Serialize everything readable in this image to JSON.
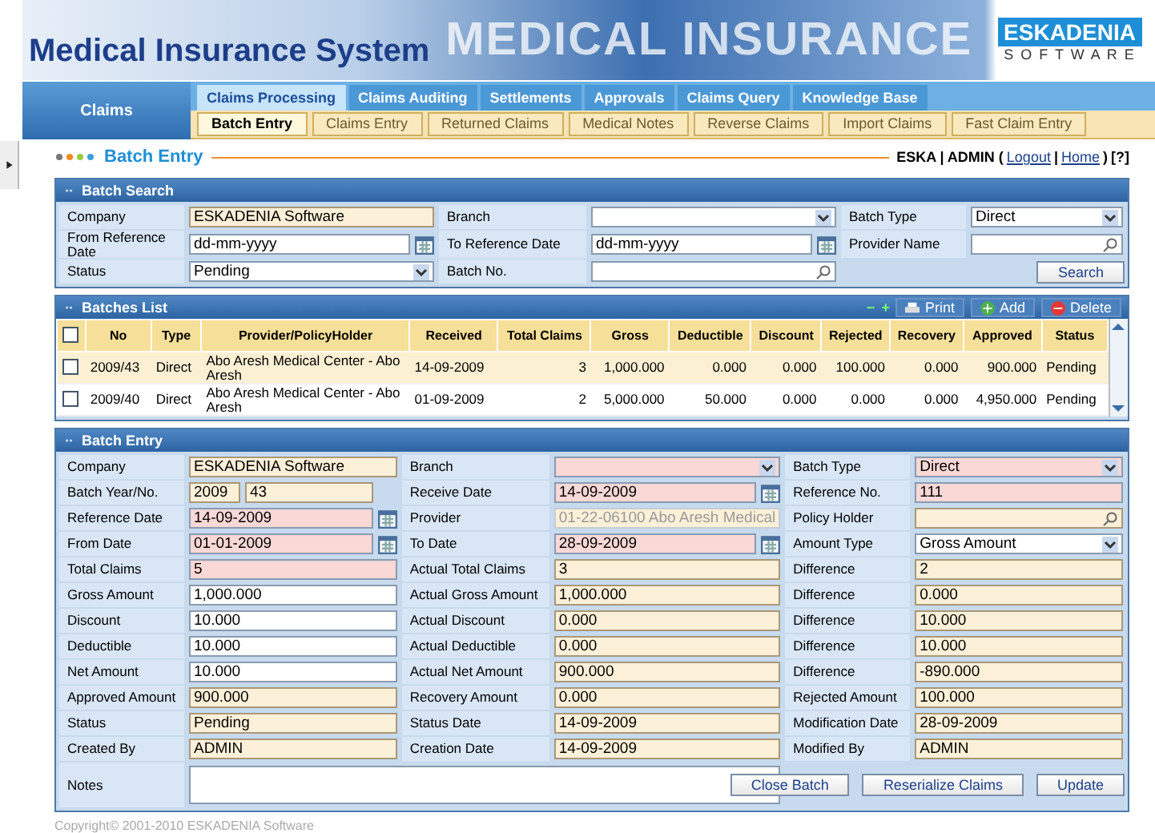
{
  "header": {
    "title": "Medical Insurance System",
    "banner_text": "MEDICAL INSURANCE",
    "logo": {
      "name": "ESKADENIA",
      "sub": "S O F T W A R E"
    }
  },
  "nav": {
    "section": "Claims",
    "tabs": [
      {
        "label": "Claims Processing",
        "selected": true
      },
      {
        "label": "Claims Auditing",
        "selected": false
      },
      {
        "label": "Settlements",
        "selected": false
      },
      {
        "label": "Approvals",
        "selected": false
      },
      {
        "label": "Claims Query",
        "selected": false
      },
      {
        "label": "Knowledge Base",
        "selected": false
      }
    ],
    "subtabs": [
      {
        "label": "Batch Entry",
        "selected": true
      },
      {
        "label": "Claims Entry",
        "selected": false
      },
      {
        "label": "Returned Claims",
        "selected": false
      },
      {
        "label": "Medical Notes",
        "selected": false
      },
      {
        "label": "Reverse Claims",
        "selected": false
      },
      {
        "label": "Import Claims",
        "selected": false
      },
      {
        "label": "Fast Claim Entry",
        "selected": false
      }
    ]
  },
  "page": {
    "title": "Batch Entry",
    "user": "ESKA | ADMIN (",
    "links": [
      "Logout",
      "Home"
    ],
    "separators": [
      "|",
      ")"
    ],
    "help": "[?]"
  },
  "search": {
    "title": "Batch Search",
    "fields": [
      {
        "label": "Company",
        "kind": "text",
        "value": "ESKADENIA Software",
        "readonly": true,
        "required": false
      },
      {
        "label": "Branch",
        "kind": "select",
        "readonly": false,
        "required": false
      },
      {
        "label": "Batch Type",
        "kind": "select",
        "value": "Direct",
        "readonly": false,
        "required": false
      },
      {
        "label": "From Reference Date",
        "kind": "date",
        "placeholder": "dd-mm-yyyy",
        "readonly": false,
        "required": false
      },
      {
        "label": "To Reference Date",
        "kind": "date",
        "placeholder": "dd-mm-yyyy",
        "readonly": false,
        "required": false
      },
      {
        "label": "Provider Name",
        "kind": "lookup",
        "readonly": false,
        "required": false
      },
      {
        "label": "Status",
        "kind": "select",
        "value": "Pending",
        "readonly": false,
        "required": false
      },
      {
        "label": "Batch No.",
        "kind": "lookup",
        "readonly": false,
        "required": false
      }
    ],
    "button": "Search"
  },
  "list": {
    "title": "Batches List",
    "all_checked": false,
    "toolbar": {
      "collapse": "−",
      "expand": "+",
      "print": "Print",
      "add": "Add",
      "delete": "Delete"
    },
    "columns": [
      "No",
      "Type",
      "Provider/PolicyHolder",
      "Received",
      "Total Claims",
      "Gross",
      "Deductible",
      "Discount",
      "Rejected",
      "Recovery",
      "Approved",
      "Status"
    ],
    "rows": [
      {
        "checked": false,
        "selected": true,
        "cells": [
          "2009/43",
          "Direct",
          "Abo Aresh Medical Center - Abo Aresh",
          "14-09-2009",
          "3",
          "1,000.000",
          "0.000",
          "0.000",
          "100.000",
          "0.000",
          "900.000",
          "Pending"
        ]
      },
      {
        "checked": false,
        "selected": false,
        "cells": [
          "2009/40",
          "Direct",
          "Abo Aresh Medical Center - Abo Aresh",
          "01-09-2009",
          "2",
          "5,000.000",
          "50.000",
          "0.000",
          "0.000",
          "0.000",
          "4,950.000",
          "Pending"
        ]
      }
    ]
  },
  "entry": {
    "title": "Batch Entry",
    "fields": [
      {
        "label": "Company",
        "kind": "text",
        "value": "ESKADENIA Software",
        "readonly": true,
        "required": false,
        "disabled": false
      },
      {
        "label": "Branch",
        "kind": "select",
        "readonly": false,
        "required": true,
        "disabled": false
      },
      {
        "label": "Batch Type",
        "kind": "select",
        "value": "Direct",
        "readonly": false,
        "required": true,
        "disabled": false
      },
      {
        "label": "Batch Year/No.",
        "kind": "pair",
        "values": [
          "2009",
          "43"
        ],
        "readonly": true,
        "required": false,
        "disabled": false
      },
      {
        "label": "Receive Date",
        "kind": "date",
        "value": "14-09-2009",
        "readonly": false,
        "required": true,
        "disabled": false
      },
      {
        "label": "Reference No.",
        "kind": "text",
        "value": "111",
        "readonly": false,
        "required": true,
        "disabled": false
      },
      {
        "label": "Reference Date",
        "kind": "date",
        "value": "14-09-2009",
        "readonly": false,
        "required": true,
        "disabled": false
      },
      {
        "label": "Provider",
        "kind": "text",
        "value": "01-22-06100 Abo Aresh Medical",
        "readonly": true,
        "required": false,
        "disabled": true
      },
      {
        "label": "Policy Holder",
        "kind": "lookup",
        "readonly": true,
        "required": false,
        "disabled": false
      },
      {
        "label": "From Date",
        "kind": "date",
        "value": "01-01-2009",
        "readonly": false,
        "required": true,
        "disabled": false
      },
      {
        "label": "To Date",
        "kind": "date",
        "value": "28-09-2009",
        "readonly": false,
        "required": true,
        "disabled": false
      },
      {
        "label": "Amount Type",
        "kind": "select",
        "value": "Gross Amount",
        "readonly": false,
        "required": false,
        "disabled": false
      },
      {
        "label": "Total Claims",
        "kind": "text",
        "value": "5",
        "readonly": false,
        "required": true,
        "disabled": false
      },
      {
        "label": "Actual Total Claims",
        "kind": "text",
        "value": "3",
        "readonly": true,
        "required": false,
        "disabled": false
      },
      {
        "label": "Difference",
        "kind": "text",
        "value": "2",
        "readonly": true,
        "required": false,
        "disabled": false
      },
      {
        "label": "Gross Amount",
        "kind": "text",
        "value": "1,000.000",
        "readonly": false,
        "required": false,
        "disabled": false
      },
      {
        "label": "Actual Gross Amount",
        "kind": "text",
        "value": "1,000.000",
        "readonly": true,
        "required": false,
        "disabled": false
      },
      {
        "label": "Difference",
        "kind": "text",
        "value": "0.000",
        "readonly": true,
        "required": false,
        "disabled": false
      },
      {
        "label": "Discount",
        "kind": "text",
        "value": "10.000",
        "readonly": false,
        "required": false,
        "disabled": false
      },
      {
        "label": "Actual Discount",
        "kind": "text",
        "value": "0.000",
        "readonly": true,
        "required": false,
        "disabled": false
      },
      {
        "label": "Difference",
        "kind": "text",
        "value": "10.000",
        "readonly": true,
        "required": false,
        "disabled": false
      },
      {
        "label": "Deductible",
        "kind": "text",
        "value": "10.000",
        "readonly": false,
        "required": false,
        "disabled": false
      },
      {
        "label": "Actual Deductible",
        "kind": "text",
        "value": "0.000",
        "readonly": true,
        "required": false,
        "disabled": false
      },
      {
        "label": "Difference",
        "kind": "text",
        "value": "10.000",
        "readonly": true,
        "required": false,
        "disabled": false
      },
      {
        "label": "Net Amount",
        "kind": "text",
        "value": "10.000",
        "readonly": false,
        "required": false,
        "disabled": false
      },
      {
        "label": "Actual Net Amount",
        "kind": "text",
        "value": "900.000",
        "readonly": true,
        "required": false,
        "disabled": false
      },
      {
        "label": "Difference",
        "kind": "text",
        "value": "-890.000",
        "readonly": true,
        "required": false,
        "disabled": false
      },
      {
        "label": "Approved Amount",
        "kind": "text",
        "value": "900.000",
        "readonly": true,
        "required": false,
        "disabled": false
      },
      {
        "label": "Recovery Amount",
        "kind": "text",
        "value": "0.000",
        "readonly": true,
        "required": false,
        "disabled": false
      },
      {
        "label": "Rejected Amount",
        "kind": "text",
        "value": "100.000",
        "readonly": true,
        "required": false,
        "disabled": false
      },
      {
        "label": "Status",
        "kind": "text",
        "value": "Pending",
        "readonly": true,
        "required": false,
        "disabled": false
      },
      {
        "label": "Status Date",
        "kind": "text",
        "value": "14-09-2009",
        "readonly": true,
        "required": false,
        "disabled": false
      },
      {
        "label": "Modification Date",
        "kind": "text",
        "value": "28-09-2009",
        "readonly": true,
        "required": false,
        "disabled": false
      },
      {
        "label": "Created By",
        "kind": "text",
        "value": "ADMIN",
        "readonly": true,
        "required": false,
        "disabled": false
      },
      {
        "label": "Creation Date",
        "kind": "text",
        "value": "14-09-2009",
        "readonly": true,
        "required": false,
        "disabled": false
      },
      {
        "label": "Modified By",
        "kind": "text",
        "value": "ADMIN",
        "readonly": true,
        "required": false,
        "disabled": false
      }
    ],
    "notes_label": "Notes",
    "buttons": [
      "Close Batch",
      "Reserialize Claims",
      "Update"
    ]
  },
  "footer": "Copyright© 2001-2010 ESKADENIA Software"
}
